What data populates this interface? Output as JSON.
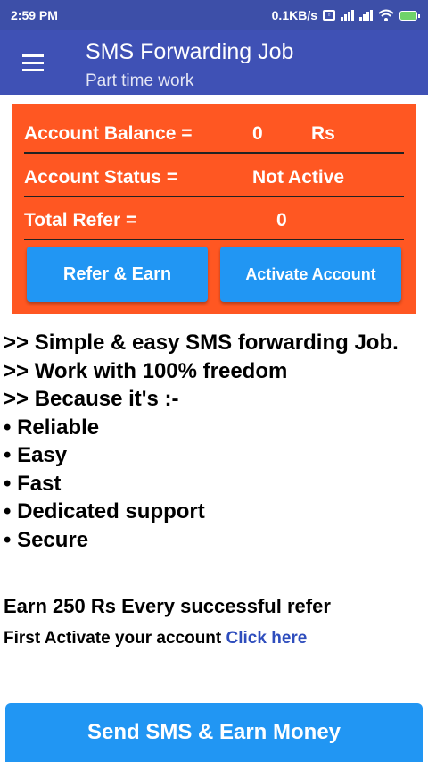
{
  "status_bar": {
    "time": "2:59 PM",
    "speed": "0.1KB/s",
    "icons": [
      "network-activity-icon",
      "signal-icon",
      "signal-icon",
      "wifi-icon",
      "battery-icon"
    ],
    "battery_color": "#6fd36a"
  },
  "app_bar": {
    "menu_icon": "hamburger-menu-icon",
    "title": "SMS Forwarding Job",
    "subtitle": "Part time work",
    "color": "#3f51b5"
  },
  "account": {
    "card_color": "#ff5722",
    "balance_label": "Account Balance =",
    "balance_value": "0",
    "balance_unit": "Rs",
    "status_label": "Account Status =",
    "status_value": "Not Active",
    "refer_label": "Total Refer =",
    "refer_value": "0",
    "refer_button": "Refer & Earn",
    "activate_button": "Activate Account"
  },
  "features": [
    ">> Simple & easy SMS forwarding Job.",
    ">> Work with 100% freedom",
    ">> Because it's :-",
    "• Reliable",
    "• Easy",
    "• Fast",
    "• Dedicated support",
    "• Secure"
  ],
  "earn_text": "Earn 250 Rs Every successful refer",
  "activate_prompt": "First Activate your account",
  "click_here": "Click here",
  "send_button": "Send SMS & Earn Money",
  "button_color": "#2196f3"
}
